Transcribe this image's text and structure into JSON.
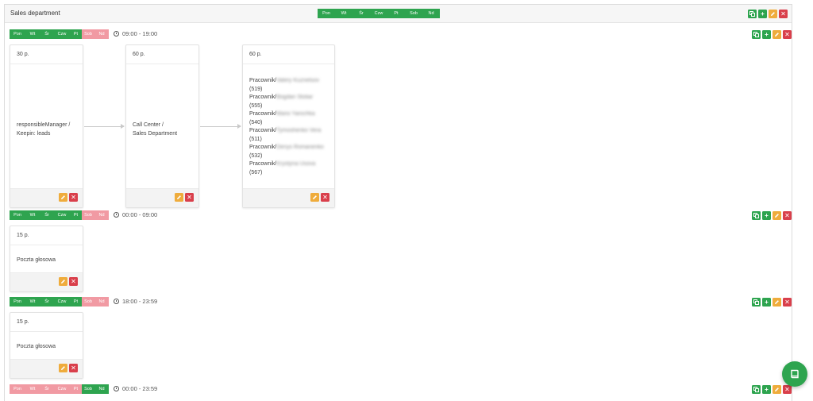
{
  "department": {
    "title": "Sales department"
  },
  "day_labels": [
    "Pon",
    "Wt",
    "Śr",
    "Czw",
    "Pt",
    "Sob",
    "Nd"
  ],
  "rows": [
    {
      "time": "09:00 - 19:00",
      "days_active": [
        true,
        true,
        true,
        true,
        true,
        false,
        false
      ],
      "cards": [
        {
          "header": "30 p.",
          "lines": [
            "responsibleManager /",
            "Keepin: leads"
          ]
        },
        {
          "header": "60 p.",
          "lines": [
            "Call Center /",
            "Sales Department"
          ]
        },
        {
          "header": "60 p.",
          "employees": [
            {
              "prefix": "Pracownik/",
              "name": "Valery Kuznetsov",
              "ext": "(519)"
            },
            {
              "prefix": "Pracownik/",
              "name": "Bogdan Stoliar",
              "ext": "(555)"
            },
            {
              "prefix": "Pracownik/",
              "name": "Mario Yarochka",
              "ext": "(540)"
            },
            {
              "prefix": "Pracownik/",
              "name": "Tymoshenko Vera",
              "ext": "(511)"
            },
            {
              "prefix": "Pracownik/",
              "name": "Denys Romanenko",
              "ext": "(532)"
            },
            {
              "prefix": "Pracownik/",
              "name": "Krystyna Usova",
              "ext": "(567)"
            }
          ]
        }
      ]
    },
    {
      "time": "00:00 - 09:00",
      "days_active": [
        true,
        true,
        true,
        true,
        true,
        false,
        false
      ],
      "cards": [
        {
          "header": "15 p.",
          "lines": [
            "Poczta głosowa"
          ]
        }
      ]
    },
    {
      "time": "18:00 - 23:59",
      "days_active": [
        true,
        true,
        true,
        true,
        true,
        false,
        false
      ],
      "cards": [
        {
          "header": "15 p.",
          "lines": [
            "Poczta głosowa"
          ]
        }
      ]
    },
    {
      "time": "00:00 - 23:59",
      "days_active": [
        false,
        false,
        false,
        false,
        false,
        true,
        true
      ],
      "cards": []
    }
  ],
  "icons": {
    "copy": "copy-icon",
    "add": "plus-icon",
    "edit": "pencil-icon",
    "delete": "close-icon",
    "fab": "book-icon",
    "clock": "clock-icon"
  },
  "colors": {
    "active_day": "#2ea44f",
    "inactive_day": "#f19aa3",
    "edit": "#efac3c",
    "delete": "#d93f4b"
  }
}
